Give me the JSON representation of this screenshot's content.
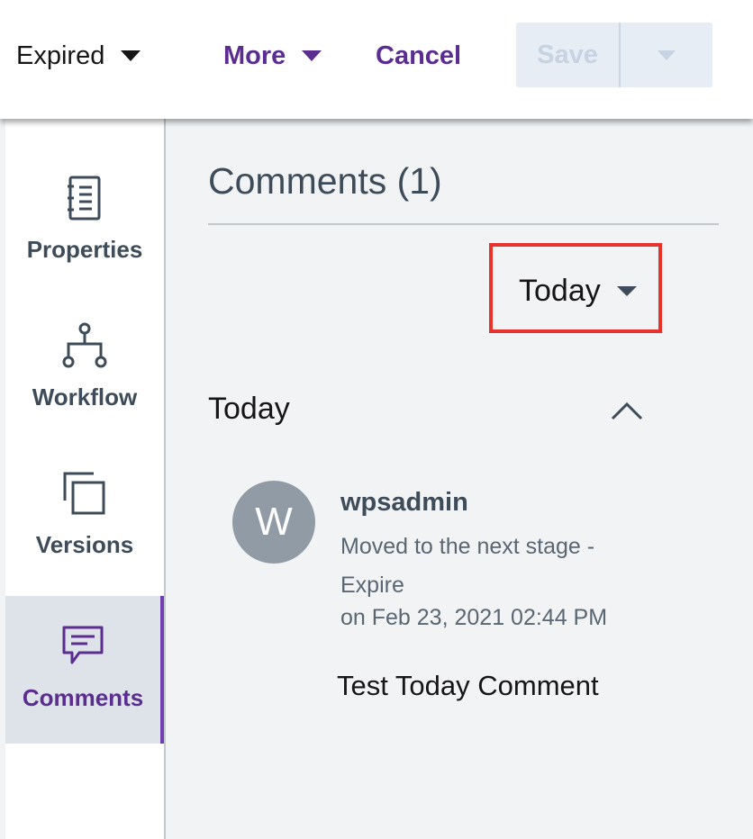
{
  "header": {
    "status": "Expired",
    "more_label": "More",
    "cancel_label": "Cancel",
    "save_label": "Save"
  },
  "sidebar": {
    "items": [
      {
        "label": "Properties",
        "icon": "properties-icon"
      },
      {
        "label": "Workflow",
        "icon": "workflow-icon"
      },
      {
        "label": "Versions",
        "icon": "versions-icon"
      },
      {
        "label": "Comments",
        "icon": "comments-icon",
        "active": true
      }
    ]
  },
  "main": {
    "title": "Comments (1)",
    "filter": "Today",
    "section_title": "Today",
    "comment": {
      "avatar_initial": "W",
      "author": "wpsadmin",
      "activity": "Moved to the next stage - Expire",
      "timestamp": "on Feb 23, 2021 02:44 PM",
      "text": "Test Today Comment"
    }
  },
  "colors": {
    "accent": "#5b2d91",
    "highlight_box": "#e8332b",
    "avatar_bg": "#909ba6",
    "save_disabled_bg": "#e6edf5"
  }
}
